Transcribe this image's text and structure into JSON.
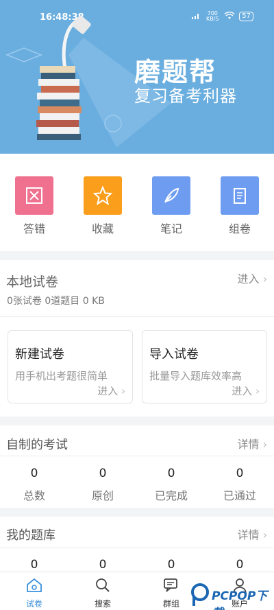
{
  "status_bar": {
    "time": "16:48:38",
    "speed": "700 KB/S",
    "battery": "57"
  },
  "banner": {
    "title": "磨题帮",
    "subtitle": "复习备考利器"
  },
  "quick_actions": [
    {
      "label": "答错",
      "icon": "wrong-answer-icon",
      "color": "#f0708f"
    },
    {
      "label": "收藏",
      "icon": "star-icon",
      "color": "#fa9e1b"
    },
    {
      "label": "笔记",
      "icon": "feather-icon",
      "color": "#6d9cf0"
    },
    {
      "label": "组卷",
      "icon": "scroll-icon",
      "color": "#6d9cf0"
    }
  ],
  "local": {
    "title": "本地试卷",
    "enter": "进入",
    "stats": "0张试卷 0道题目 0 KB",
    "new_paper": {
      "title": "新建试卷",
      "desc": "用手机出考题很简单",
      "enter": "进入"
    },
    "import_paper": {
      "title": "导入试卷",
      "desc": "批量导入题库效率高",
      "enter": "进入"
    }
  },
  "my_exams": {
    "title": "自制的考试",
    "details": "详情",
    "stats": [
      {
        "value": "0",
        "label": "总数"
      },
      {
        "value": "0",
        "label": "原创"
      },
      {
        "value": "0",
        "label": "已完成"
      },
      {
        "value": "0",
        "label": "已通过"
      }
    ]
  },
  "my_banks": {
    "title": "我的题库",
    "details": "详情",
    "values": [
      "0",
      "0",
      "0",
      "0"
    ]
  },
  "tabs": [
    {
      "label": "试卷",
      "icon": "home-icon",
      "active": true
    },
    {
      "label": "搜索",
      "icon": "search-icon",
      "active": false
    },
    {
      "label": "群组",
      "icon": "chat-icon",
      "active": false
    },
    {
      "label": "账户",
      "icon": "user-icon",
      "active": false
    }
  ],
  "watermark": {
    "text": "PCPOP下载"
  },
  "colors": {
    "banner": "#6aaedf",
    "active_tab": "#3a8fdc"
  }
}
